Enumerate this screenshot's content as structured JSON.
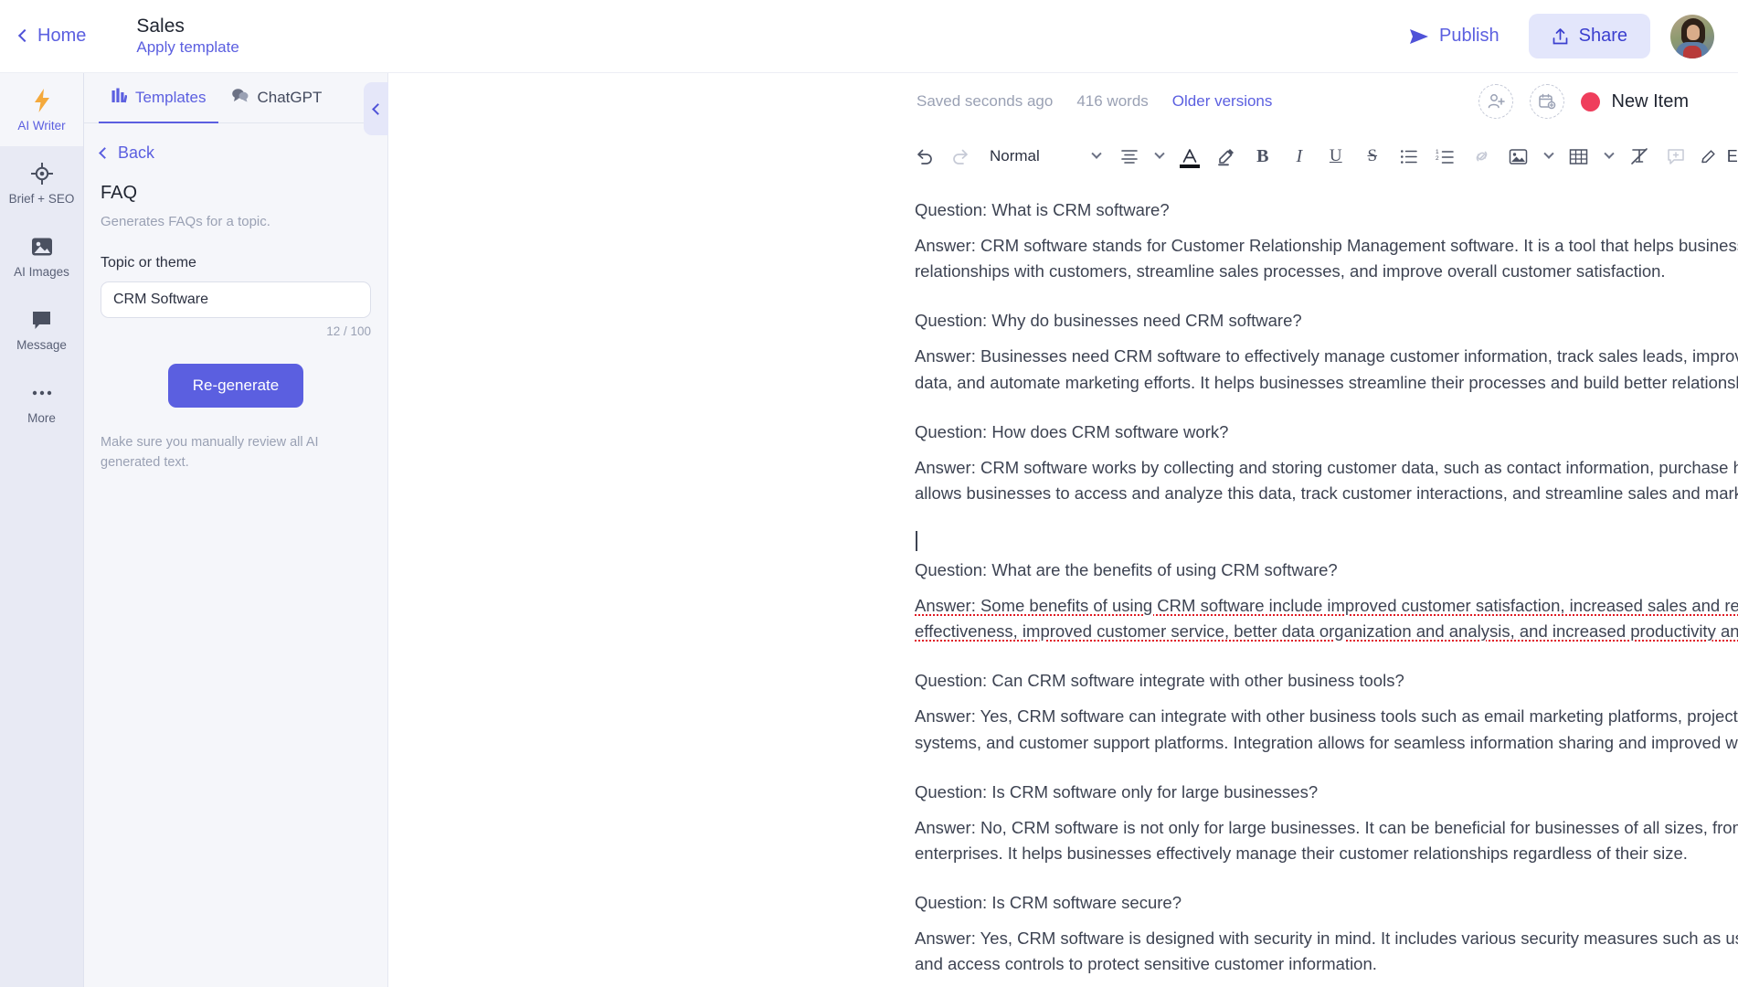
{
  "topbar": {
    "home_label": "Home",
    "doc_title": "Sales",
    "apply_template_label": "Apply template",
    "publish_label": "Publish",
    "share_label": "Share",
    "avatar_name": "user-avatar"
  },
  "rail": {
    "items": [
      {
        "label": "AI Writer",
        "icon": "lightning-icon",
        "active": true
      },
      {
        "label": "Brief + SEO",
        "icon": "target-icon",
        "active": false
      },
      {
        "label": "AI Images",
        "icon": "image-icon",
        "active": false
      },
      {
        "label": "Message",
        "icon": "chat-bubble-icon",
        "active": false
      },
      {
        "label": "More",
        "icon": "ellipsis-icon",
        "active": false
      }
    ]
  },
  "panel": {
    "tabs": [
      {
        "label": "Templates",
        "icon": "templates-icon",
        "active": true
      },
      {
        "label": "ChatGPT",
        "icon": "chat-icon",
        "active": false
      }
    ],
    "back_label": "Back",
    "template_title": "FAQ",
    "template_desc": "Generates FAQs for a topic.",
    "field_label": "Topic or theme",
    "field_value": "CRM Software",
    "field_placeholder": "Topic or theme",
    "char_count": "12 / 100",
    "regenerate_label": "Re-generate",
    "note": "Make sure you manually review all AI generated text.",
    "collapse_icon": "chevron-left-icon"
  },
  "editor": {
    "saved_text": "Saved seconds ago",
    "word_count": "416 words",
    "older_versions_label": "Older versions",
    "add_person_icon": "add-person-icon",
    "schedule_icon": "calendar-add-icon",
    "status_label": "New Item",
    "status_color": "#ef3e5c",
    "toolbar": {
      "undo": "undo-icon",
      "redo": "redo-icon",
      "style_value": "Normal",
      "align": "align-icon",
      "font_color": "font-color-icon",
      "highlight": "highlighter-icon",
      "bold": "B",
      "italic": "I",
      "underline": "U",
      "strikethrough": "S",
      "bullet_list": "bullet-list-icon",
      "numbered_list": "numbered-list-icon",
      "link": "link-icon",
      "image": "image-icon",
      "table": "table-icon",
      "clear_format": "clear-format-icon",
      "comment": "comment-icon",
      "mode_label": "Editing",
      "more": "ellipsis-icon"
    }
  },
  "document": {
    "blocks": [
      {
        "question": "Question: What is CRM software?",
        "answer": "Answer: CRM software stands for Customer Relationship Management software. It is a tool that helps businesses manage their interactions and relationships with customers, streamline sales processes, and improve overall customer satisfaction.",
        "flagged": false,
        "caret_before": false
      },
      {
        "question": "Question: Why do businesses need CRM software?",
        "answer": "Answer: Businesses need CRM software to effectively manage customer information, track sales leads, improve customer service, analyze sales data, and automate marketing efforts. It helps businesses streamline their processes and build better relationships with their customers.",
        "flagged": false,
        "caret_before": false
      },
      {
        "question": "Question: How does CRM software work?",
        "answer": "Answer: CRM software works by collecting and storing customer data, such as contact information, purchase history, and communication logs. It allows businesses to access and analyze this data, track customer interactions, and streamline sales and marketing processes.",
        "flagged": false,
        "caret_before": false
      },
      {
        "question": "Question: What are the benefits of using CRM software?",
        "answer": "Answer: Some benefits of using CRM software include improved customer satisfaction, increased sales and revenue, enhanced marketing effectiveness, improved customer service, better data organization and analysis, and increased productivity and efficiency.",
        "flagged": true,
        "caret_before": true
      },
      {
        "question": "Question: Can CRM software integrate with other business tools?",
        "answer": "Answer: Yes, CRM software can integrate with other business tools such as email marketing platforms, project management software, billing systems, and customer support platforms. Integration allows for seamless information sharing and improved workflow.",
        "flagged": false,
        "caret_before": false
      },
      {
        "question": "Question: Is CRM software only for large businesses?",
        "answer": "Answer: No, CRM software is not only for large businesses. It can be beneficial for businesses of all sizes, from small startups to large enterprises. It helps businesses effectively manage their customer relationships regardless of their size.",
        "flagged": false,
        "caret_before": false
      },
      {
        "question": "Question: Is CRM software secure?",
        "answer": "Answer: Yes, CRM software is designed with security in mind. It includes various security measures such as user authentication, data encryption, and access controls to protect sensitive customer information.",
        "flagged": false,
        "caret_before": false
      }
    ]
  },
  "colors": {
    "accent": "#5b5fe0",
    "rail_bg": "#e8eaf4",
    "panel_bg": "#f5f6fa",
    "status": "#ef3e5c",
    "spellcheck": "#e01b24"
  }
}
